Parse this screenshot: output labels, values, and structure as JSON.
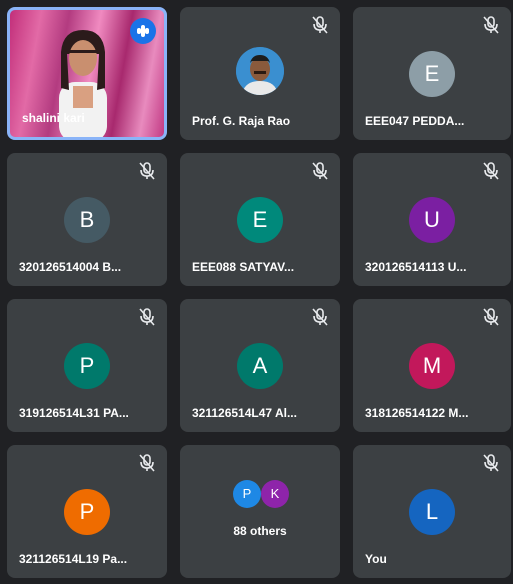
{
  "participants": [
    {
      "name": "shalini kari",
      "type": "video",
      "speaking": true
    },
    {
      "name": "Prof. G. Raja Rao",
      "type": "photo",
      "muted": true
    },
    {
      "name": "EEE047 PEDDA...",
      "initial": "E",
      "color": "#8d9ea7",
      "muted": true
    },
    {
      "name": "320126514004 B...",
      "initial": "B",
      "color": "#455a64",
      "muted": true
    },
    {
      "name": "EEE088 SATYAV...",
      "initial": "E",
      "color": "#00897b",
      "muted": true
    },
    {
      "name": "320126514113 U...",
      "initial": "U",
      "color": "#7b1fa2",
      "muted": true
    },
    {
      "name": "319126514L31 PA...",
      "initial": "P",
      "color": "#00796b",
      "muted": true
    },
    {
      "name": "321126514L47 Al...",
      "initial": "A",
      "color": "#00796b",
      "muted": true
    },
    {
      "name": "318126514122 M...",
      "initial": "M",
      "color": "#c2185b",
      "muted": true
    },
    {
      "name": "321126514L19 Pa...",
      "initial": "P",
      "color": "#ef6c00",
      "muted": true
    },
    {
      "name": "88 others",
      "type": "others",
      "initials": [
        "P",
        "K"
      ],
      "colors": [
        "#1e88e5",
        "#8e24aa"
      ]
    },
    {
      "name": "You",
      "initial": "L",
      "color": "#1565c0",
      "muted": true
    }
  ],
  "icons": {
    "muted": "mic-off-icon",
    "speaking": "audio-level-icon"
  }
}
